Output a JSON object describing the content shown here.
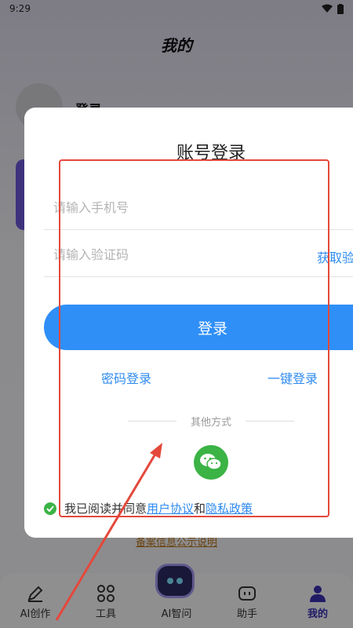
{
  "status_bar": {
    "time": "9:29"
  },
  "background": {
    "page_title": "我的",
    "login_text": "登录",
    "filing_link": "备案信息公示说明"
  },
  "bottom_nav": {
    "items": [
      {
        "label": "AI创作",
        "icon": "pen-icon"
      },
      {
        "label": "工具",
        "icon": "grid-icon"
      },
      {
        "label": "AI智问",
        "icon": "robot-icon"
      },
      {
        "label": "助手",
        "icon": "assistant-icon"
      },
      {
        "label": "我的",
        "icon": "person-icon",
        "active": true
      }
    ]
  },
  "login_modal": {
    "title": "账号登录",
    "phone_placeholder": "请输入手机号",
    "code_placeholder": "请输入验证码",
    "get_code_label": "获取验证码",
    "login_button": "登录",
    "password_login": "密码登录",
    "one_key_login": "一键登录",
    "other_methods": "其他方式",
    "wechat_icon": "wechat-icon",
    "agreement_prefix": "我已阅读并同意",
    "user_agreement": "用户协议",
    "and_text": "和",
    "privacy_policy": "隐私政策"
  },
  "colors": {
    "accent": "#2f8ff7",
    "link": "#2f8bf0",
    "wechat_green": "#3bb345",
    "annotation_red": "#e4483b",
    "nav_active": "#3a2fb0"
  }
}
